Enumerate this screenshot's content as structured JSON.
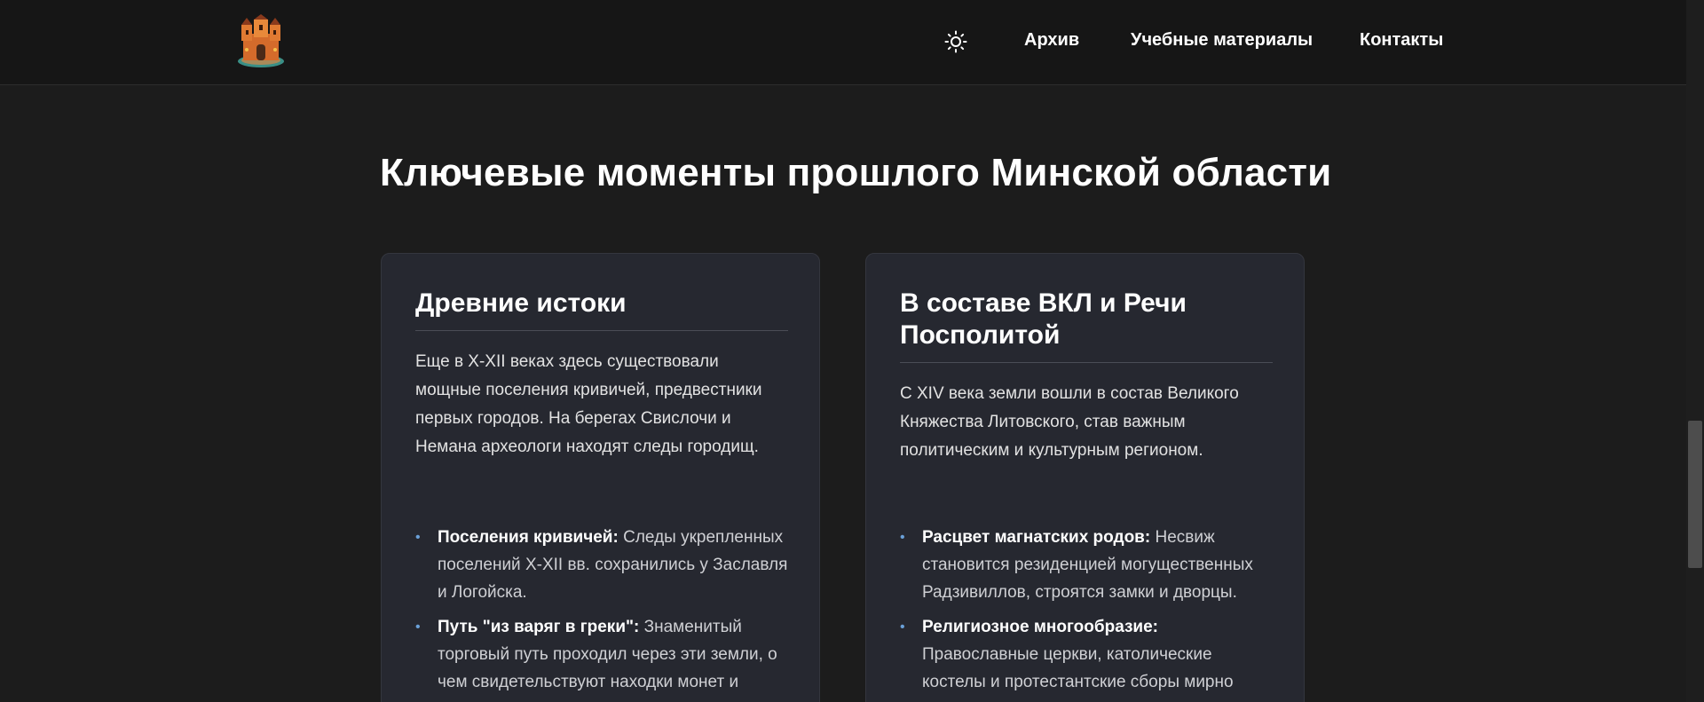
{
  "header": {
    "logo_alt": "castle-logo",
    "theme_icon": "sun-icon",
    "nav": [
      {
        "label": "Архив"
      },
      {
        "label": "Учебные материалы"
      },
      {
        "label": "Контакты"
      }
    ]
  },
  "main": {
    "title": "Ключевые моменты прошлого Минской области",
    "cards": [
      {
        "title": "Древние истоки",
        "text": "Еще в X-XII веках здесь существовали мощные поселения кривичей, предвестники первых городов. На берегах Свислочи и Немана археологи находят следы городищ.",
        "items": [
          {
            "bold": "Поселения кривичей:",
            "text": " Следы укрепленных поселений X-XII вв. сохранились у Заславля и Логойска."
          },
          {
            "bold": "Путь \"из варяг в греки\":",
            "text": " Знаменитый торговый путь проходил через эти земли, о чем свидетельствуют находки монет и"
          }
        ]
      },
      {
        "title": "В составе ВКЛ и Речи Посполитой",
        "text": "С XIV века земли вошли в состав Великого Княжества Литовского, став важным политическим и культурным регионом.",
        "items": [
          {
            "bold": "Расцвет магнатских родов:",
            "text": " Несвиж становится резиденцией могущественных Радзивиллов, строятся замки и дворцы."
          },
          {
            "bold": "Религиозное многообразие:",
            "text": " Православные церкви, католические костелы и протестантские сборы мирно"
          }
        ]
      }
    ]
  },
  "colors": {
    "background": "#1c1c1c",
    "header": "#161616",
    "card": "#262830",
    "bullet": "#6aa0d8"
  }
}
